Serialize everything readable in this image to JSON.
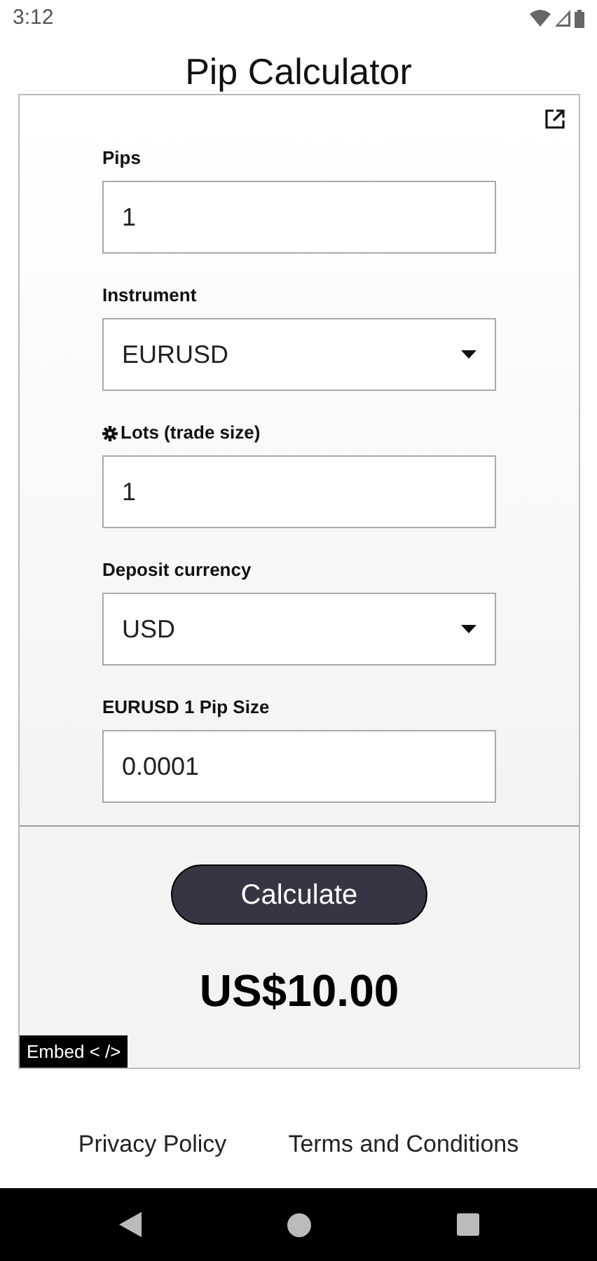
{
  "status_bar": {
    "time": "3:12"
  },
  "title": "Pip Calculator",
  "fields": [
    {
      "kind": "input",
      "label": "Pips",
      "value": "1",
      "icon": false
    },
    {
      "kind": "select",
      "label": "Instrument",
      "value": "EURUSD",
      "icon": false
    },
    {
      "kind": "input",
      "label": "Lots (trade size)",
      "value": "1",
      "icon": true
    },
    {
      "kind": "select",
      "label": "Deposit currency",
      "value": "USD",
      "icon": false
    },
    {
      "kind": "input",
      "label": "EURUSD 1 Pip Size",
      "value": "0.0001",
      "icon": false
    }
  ],
  "calculate_button": "Calculate",
  "result": "US$10.00",
  "embed_button": "Embed < />",
  "footer_links": [
    "Privacy Policy",
    "Terms and Conditions"
  ]
}
